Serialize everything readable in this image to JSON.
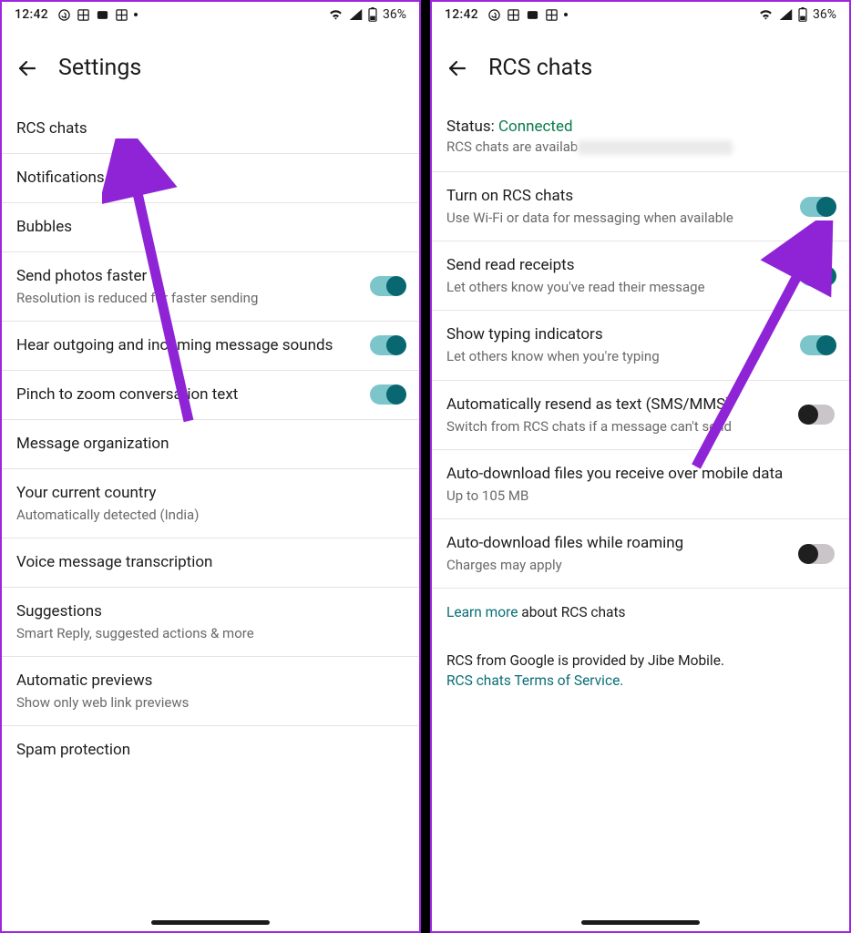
{
  "statusbar": {
    "time": "12:42",
    "battery": "36%"
  },
  "left": {
    "title": "Settings",
    "items": [
      {
        "title": "RCS chats"
      },
      {
        "title": "Notifications"
      },
      {
        "title": "Bubbles"
      },
      {
        "title": "Send photos faster",
        "sub": "Resolution is reduced for faster sending",
        "toggle": "on"
      },
      {
        "title": "Hear outgoing and incoming message sounds",
        "toggle": "on"
      },
      {
        "title": "Pinch to zoom conversation text",
        "toggle": "on"
      },
      {
        "title": "Message organization"
      },
      {
        "title": "Your current country",
        "sub": "Automatically detected (India)"
      },
      {
        "title": "Voice message transcription"
      },
      {
        "title": "Suggestions",
        "sub": "Smart Reply, suggested actions & more"
      },
      {
        "title": "Automatic previews",
        "sub": "Show only web link previews"
      },
      {
        "title": "Spam protection"
      }
    ]
  },
  "right": {
    "title": "RCS chats",
    "status_label": "Status: ",
    "status_value": "Connected",
    "status_sub": "RCS chats are availab",
    "items": [
      {
        "title": "Turn on RCS chats",
        "sub": "Use Wi-Fi or data for messaging when available",
        "toggle": "on"
      },
      {
        "title": "Send read receipts",
        "sub": "Let others know you've read their message",
        "toggle": "on"
      },
      {
        "title": "Show typing indicators",
        "sub": "Let others know when you're typing",
        "toggle": "on"
      },
      {
        "title": "Automatically resend as text (SMS/MMS)",
        "sub": "Switch from RCS chats if a message can't send",
        "toggle": "off"
      },
      {
        "title": "Auto-download files you receive over mobile data",
        "sub": "Up to 105 MB"
      },
      {
        "title": "Auto-download files while roaming",
        "sub": "Charges may apply",
        "toggle": "off"
      }
    ],
    "learn_more": "Learn more",
    "learn_more_suffix": " about RCS chats",
    "provider": "RCS from Google is provided by Jibe Mobile.",
    "tos": "RCS chats Terms of Service."
  }
}
